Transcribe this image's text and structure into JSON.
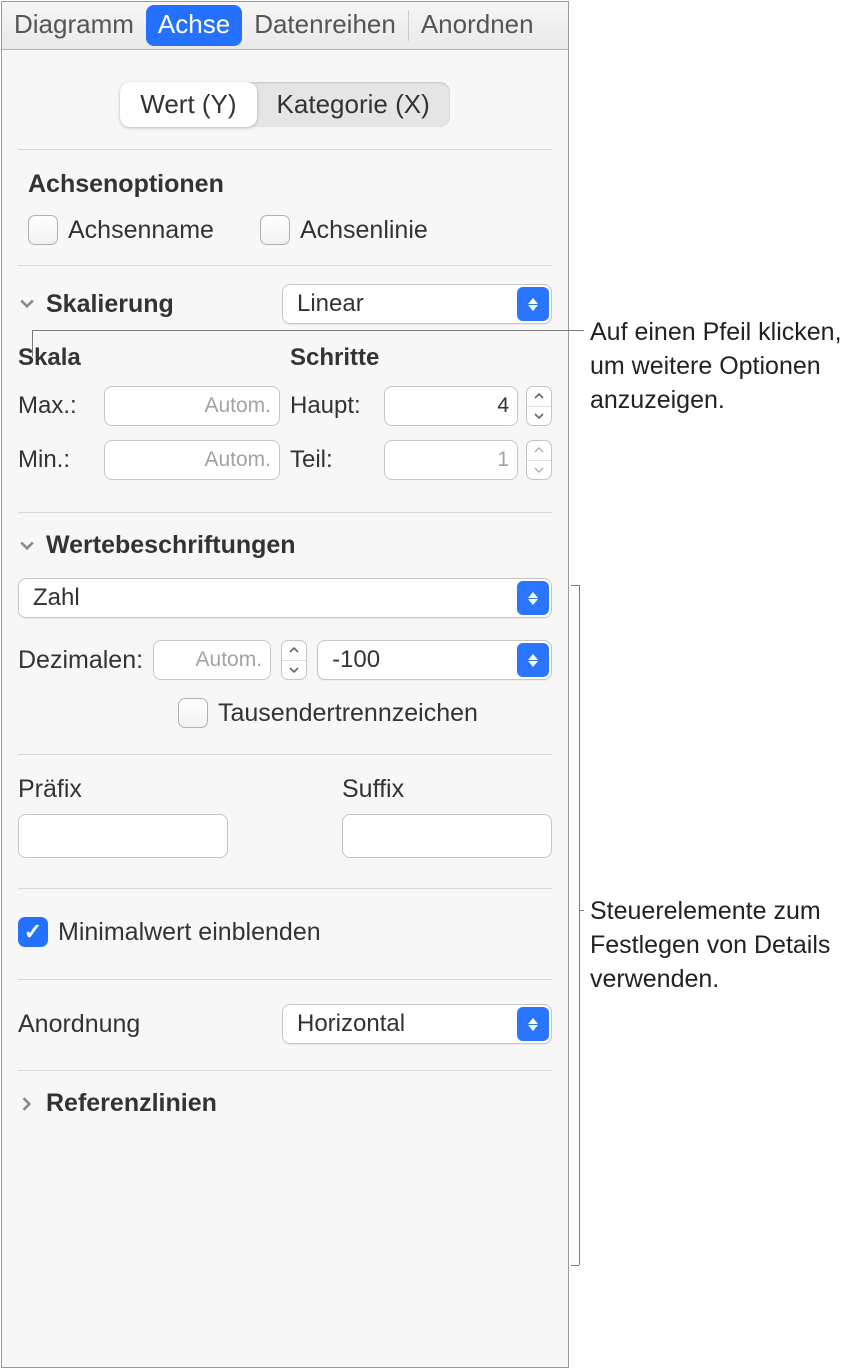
{
  "topTabs": {
    "t1": "Diagramm",
    "t2": "Achse",
    "t3": "Datenreihen",
    "t4": "Anordnen"
  },
  "segTabs": {
    "s1": "Wert (Y)",
    "s2": "Kategorie (X)"
  },
  "axisOptions": {
    "title": "Achsenoptionen",
    "axisName": "Achsenname",
    "axisLine": "Achsenlinie"
  },
  "scaling": {
    "title": "Skalierung",
    "type": "Linear",
    "scaleTitle": "Skala",
    "stepsTitle": "Schritte",
    "maxLabel": "Max.:",
    "minLabel": "Min.:",
    "autoPlaceholder": "Autom.",
    "majorLabel": "Haupt:",
    "minorLabel": "Teil:",
    "majorValue": "4",
    "minorValue": "1"
  },
  "valueLabels": {
    "title": "Wertebeschriftungen",
    "format": "Zahl",
    "decimalsLabel": "Dezimalen:",
    "decimalsPlaceholder": "Autom.",
    "negFormat": "-100",
    "thousandsSep": "Tausendertrennzeichen",
    "prefixLabel": "Präfix",
    "suffixLabel": "Suffix",
    "showMin": "Minimalwert einblenden",
    "orientationLabel": "Anordnung",
    "orientationValue": "Horizontal"
  },
  "refLines": {
    "title": "Referenzlinien"
  },
  "annotations": {
    "a1": "Auf einen Pfeil klicken, um weitere Optionen anzuzeigen.",
    "a2": "Steuerelemente zum Festlegen von Details verwenden."
  }
}
